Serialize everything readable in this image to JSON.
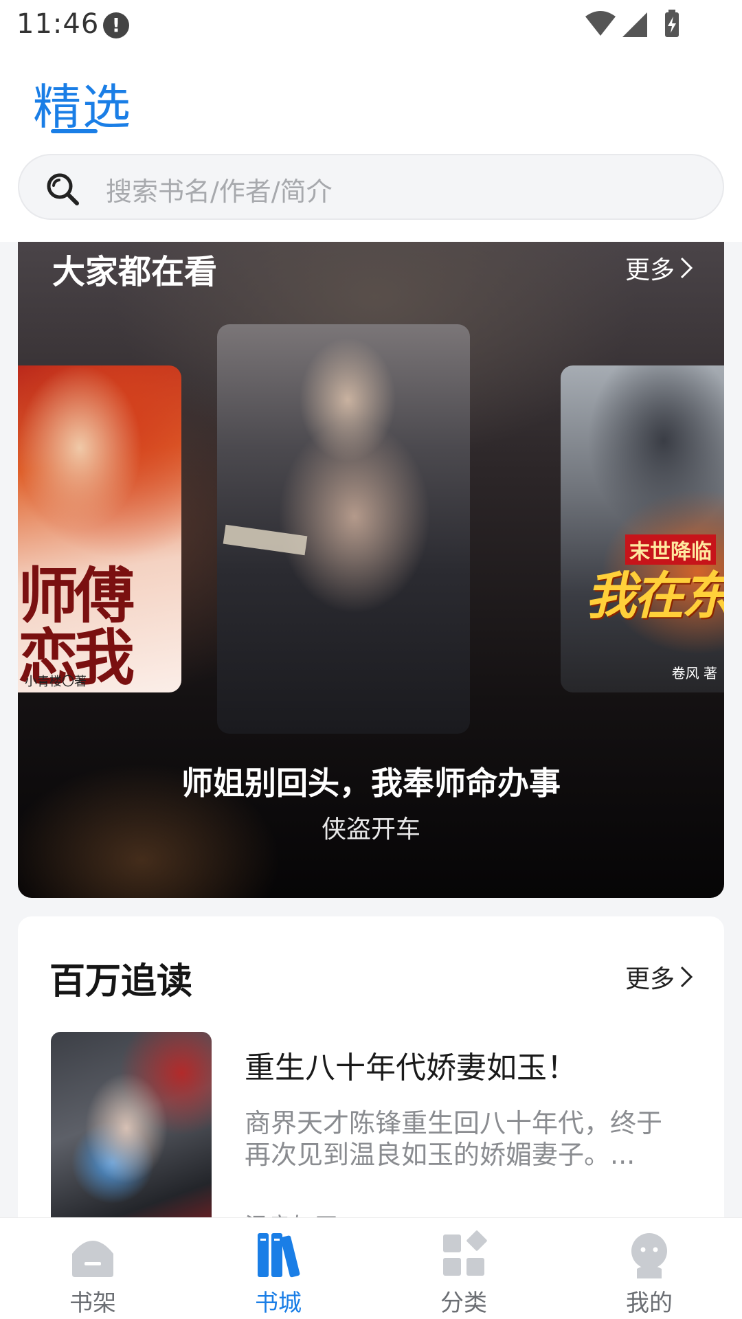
{
  "status_bar": {
    "time": "11:46",
    "alert_glyph": "!"
  },
  "header": {
    "tab_label": "精选",
    "search_placeholder": "搜索书名/作者/简介"
  },
  "trending": {
    "title": "大家都在看",
    "more_label": "更多",
    "left_cover": {
      "title": "师傅恋我",
      "author": "小青楼〇著"
    },
    "center_cover": {
      "title": "师姐别回头，我奉师命办事",
      "author": "侠盗开车"
    },
    "right_cover": {
      "tag": "末世降临",
      "title": "我在东杀疯",
      "author": "卷风 著"
    }
  },
  "million_reads": {
    "title": "百万追读",
    "more_label": "更多",
    "book": {
      "title": "重生八十年代娇妻如玉！",
      "description": "商界天才陈锋重生回八十年代，终于再次见到温良如玉的娇媚妻子。...",
      "author": "温良如玉"
    }
  },
  "bottom_nav": {
    "items": [
      {
        "label": "书架",
        "icon": "bookshelf-icon",
        "active": false
      },
      {
        "label": "书城",
        "icon": "bookstore-icon",
        "active": true
      },
      {
        "label": "分类",
        "icon": "category-icon",
        "active": false
      },
      {
        "label": "我的",
        "icon": "profile-icon",
        "active": false
      }
    ]
  },
  "colors": {
    "accent": "#1a7ee6",
    "inactive_icon": "#c9ccd1",
    "background": "#f4f5f7"
  }
}
